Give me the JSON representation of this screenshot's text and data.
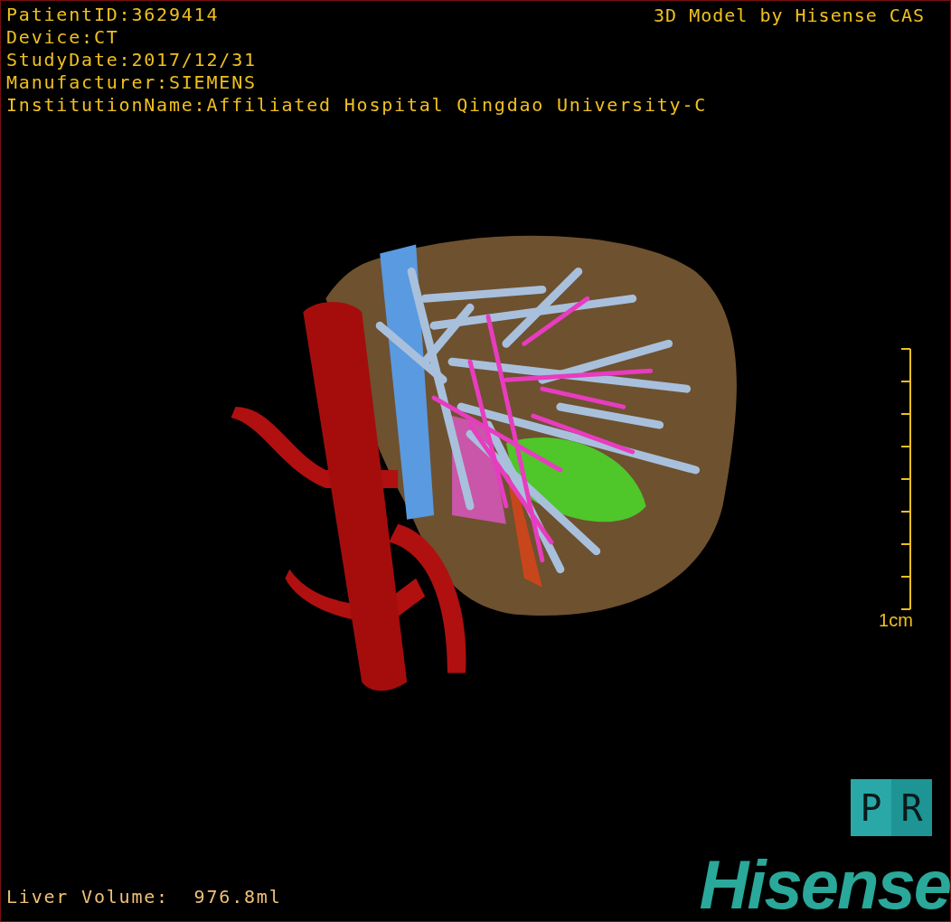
{
  "patient_info": [
    "PatientID:3629414",
    "Device:CT",
    "StudyDate:2017/12/31",
    "Manufacturer:SIEMENS",
    "InstitutionName:Affiliated Hospital Qingdao University-C"
  ],
  "credit": "3D Model by Hisense CAS",
  "scale_bar": {
    "label": "1cm"
  },
  "orientation_cube": {
    "faces": [
      "P",
      "R"
    ]
  },
  "liver_volume": "Liver Volume:  976.8ml",
  "brand": "Hisense"
}
